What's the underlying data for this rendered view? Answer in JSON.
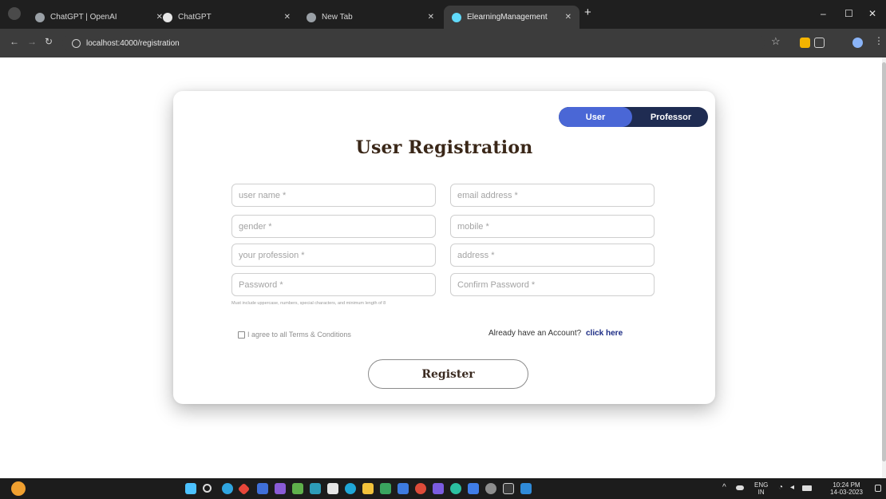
{
  "browser": {
    "tabs": [
      {
        "label": "ChatGPT | OpenAI",
        "fav_color": "#9aa0a6"
      },
      {
        "label": "ChatGPT",
        "fav_color": "#e6e6e6"
      },
      {
        "label": "New Tab",
        "fav_color": "#9aa0a6"
      },
      {
        "label": "ElearningManagement",
        "fav_color": "#61dafb"
      }
    ],
    "new_tab_label": "+",
    "url": "localhost:4000/registration",
    "window_controls": {
      "minimize": "–",
      "maximize": "☐",
      "close": "✕"
    }
  },
  "form": {
    "toggle": {
      "user": "User",
      "professor": "Professor"
    },
    "title": "User Registration",
    "fields": {
      "user_name": "user name *",
      "email": "email address *",
      "gender": "gender *",
      "mobile": "mobile *",
      "profession": "your profession *",
      "address": "address *",
      "password": "Password *",
      "confirm_password": "Confirm Password *"
    },
    "password_hint": "Must include uppercase, numbers, special characters, and minimum length of 8",
    "terms_label": "I agree to all Terms & Conditions",
    "have_account": "Already have an Account?",
    "click_here": "click here",
    "register_label": "Register"
  },
  "taskbar": {
    "lang": "ENG",
    "lang_sub": "IN",
    "time": "10:24 PM",
    "date": "14-03-2023"
  },
  "colors": {
    "toggle_active": "#4a67d6",
    "toggle_bg": "#1f2c52",
    "link": "#1b2b84",
    "title": "#3a2718"
  }
}
